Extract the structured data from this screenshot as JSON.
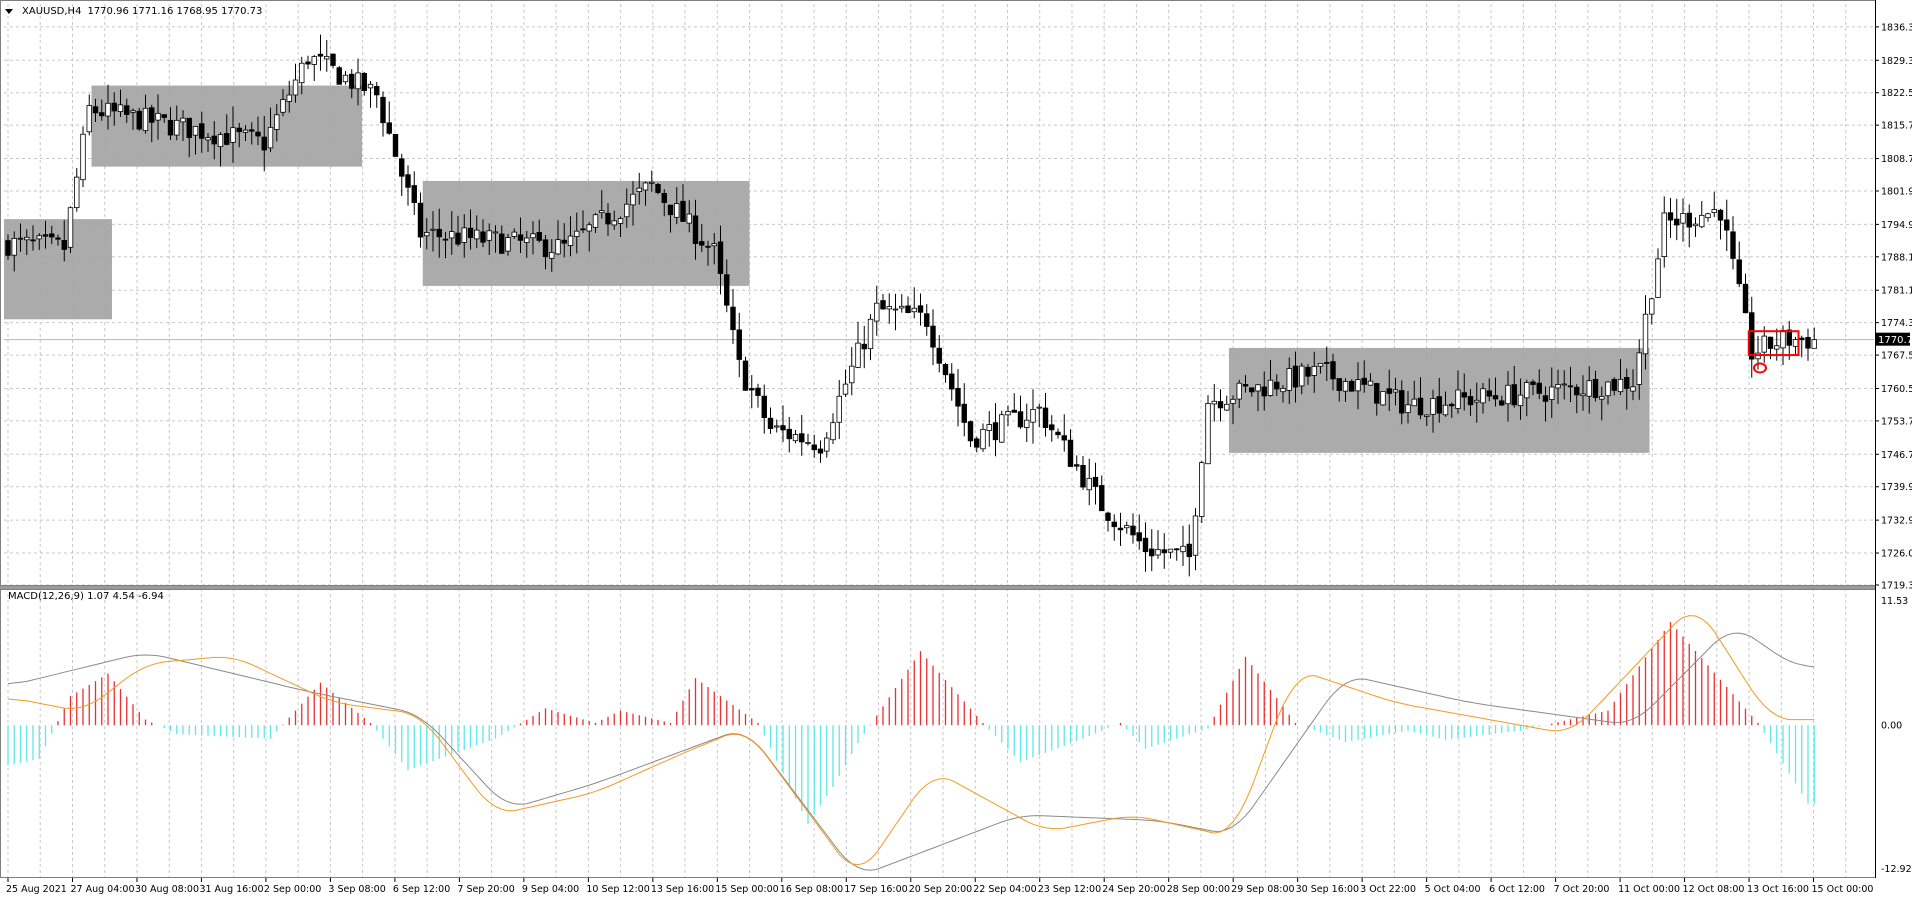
{
  "instrument": {
    "symbol_timeframe": "XAUUSD,H4",
    "ohlc": "1770.96 1771.16 1768.95 1770.73"
  },
  "current_price": "1770.73",
  "indicator": {
    "label": "MACD(12,26,9) 1.07 4.54 -6.94",
    "scale_top": "11.53",
    "scale_zero": "0.00",
    "scale_bottom": "-12.92"
  },
  "colors": {
    "background": "#ffffff",
    "grid": "#c8c8c8",
    "bull_body": "#ffffff",
    "bear_body": "#000000",
    "wick": "#000000",
    "range_box": "#a6a6a6",
    "histogram_positive": "#e8302f",
    "histogram_negative": "#5ee8e8",
    "macd_line": "#f39a22",
    "signal_line": "#8a8a8a",
    "price_line": "#b4b4b4",
    "annotation": "#ff0000"
  },
  "chart_data": [
    {
      "type": "candlestick",
      "y_ticks": [
        "1836.30",
        "1829.30",
        "1822.50",
        "1815.70",
        "1808.70",
        "1801.90",
        "1794.90",
        "1788.10",
        "1781.10",
        "1774.30",
        "1767.50",
        "1760.50",
        "1753.70",
        "1746.70",
        "1739.90",
        "1732.90",
        "1726.00",
        "1719.30"
      ],
      "ylim": [
        1719.3,
        1839.0
      ],
      "x_ticks": [
        "25 Aug 2021",
        "27 Aug 04:00",
        "30 Aug 08:00",
        "31 Aug 16:00",
        "2 Sep 00:00",
        "3 Sep 08:00",
        "6 Sep 12:00",
        "7 Sep 20:00",
        "9 Sep 04:00",
        "10 Sep 12:00",
        "13 Sep 16:00",
        "15 Sep 00:00",
        "16 Sep 08:00",
        "17 Sep 16:00",
        "20 Sep 20:00",
        "22 Sep 04:00",
        "23 Sep 12:00",
        "24 Sep 20:00",
        "28 Sep 00:00",
        "29 Sep 08:00",
        "30 Sep 16:00",
        "3 Oct 22:00",
        "5 Oct 04:00",
        "6 Oct 12:00",
        "7 Oct 20:00",
        "11 Oct 00:00",
        "12 Oct 08:00",
        "13 Oct 16:00",
        "15 Oct 00:00"
      ],
      "last_close": 1770.73,
      "key_points": [
        {
          "bar": 0,
          "price": 1791
        },
        {
          "bar": 10,
          "price": 1790
        },
        {
          "bar": 14,
          "price": 1819
        },
        {
          "bar": 42,
          "price": 1812
        },
        {
          "bar": 49,
          "price": 1830
        },
        {
          "bar": 60,
          "price": 1822
        },
        {
          "bar": 67,
          "price": 1793
        },
        {
          "bar": 90,
          "price": 1790
        },
        {
          "bar": 104,
          "price": 1803
        },
        {
          "bar": 114,
          "price": 1789
        },
        {
          "bar": 118,
          "price": 1765
        },
        {
          "bar": 123,
          "price": 1752
        },
        {
          "bar": 131,
          "price": 1749
        },
        {
          "bar": 140,
          "price": 1777
        },
        {
          "bar": 148,
          "price": 1775
        },
        {
          "bar": 155,
          "price": 1750
        },
        {
          "bar": 166,
          "price": 1756
        },
        {
          "bar": 176,
          "price": 1736
        },
        {
          "bar": 183,
          "price": 1727
        },
        {
          "bar": 190,
          "price": 1725
        },
        {
          "bar": 193,
          "price": 1758
        },
        {
          "bar": 211,
          "price": 1764
        },
        {
          "bar": 225,
          "price": 1757
        },
        {
          "bar": 248,
          "price": 1760
        },
        {
          "bar": 261,
          "price": 1762
        },
        {
          "bar": 266,
          "price": 1795
        },
        {
          "bar": 275,
          "price": 1798
        },
        {
          "bar": 280,
          "price": 1768
        },
        {
          "bar": 285,
          "price": 1770.73
        }
      ],
      "range_boxes": [
        {
          "from_bar": 0,
          "to_bar": 16,
          "high": 1796,
          "low": 1775
        },
        {
          "from_bar": 14,
          "to_bar": 56,
          "high": 1824,
          "low": 1807
        },
        {
          "from_bar": 67,
          "to_bar": 118,
          "high": 1804,
          "low": 1782
        },
        {
          "from_bar": 196,
          "to_bar": 262,
          "high": 1769,
          "low": 1747
        }
      ]
    },
    {
      "type": "macd",
      "ylim": [
        -12.92,
        11.53
      ],
      "macd": {
        "name": "MACD",
        "key_points": [
          [
            0,
            2.5
          ],
          [
            12,
            1.2
          ],
          [
            22,
            5.5
          ],
          [
            36,
            6.2
          ],
          [
            52,
            2.0
          ],
          [
            66,
            1.0
          ],
          [
            78,
            -8.0
          ],
          [
            94,
            -6.0
          ],
          [
            108,
            -2.5
          ],
          [
            118,
            -0.2
          ],
          [
            136,
            -13.8
          ],
          [
            148,
            -4.0
          ],
          [
            166,
            -9.5
          ],
          [
            180,
            -8.0
          ],
          [
            196,
            -10.0
          ],
          [
            206,
            5.0
          ],
          [
            222,
            2.0
          ],
          [
            250,
            -0.8
          ],
          [
            270,
            11.0
          ],
          [
            282,
            0.5
          ]
        ]
      },
      "signal": {
        "name": "Signal",
        "key_points": [
          [
            0,
            3.5
          ],
          [
            22,
            6.5
          ],
          [
            48,
            3.0
          ],
          [
            66,
            1.0
          ],
          [
            80,
            -7.5
          ],
          [
            94,
            -5.2
          ],
          [
            118,
            -0.2
          ],
          [
            136,
            -13.5
          ],
          [
            162,
            -8.0
          ],
          [
            184,
            -8.5
          ],
          [
            196,
            -9.8
          ],
          [
            214,
            4.5
          ],
          [
            234,
            2.0
          ],
          [
            260,
            0.0
          ],
          [
            276,
            9.0
          ],
          [
            286,
            5.2
          ]
        ]
      },
      "histogram": {
        "name": "Histogram",
        "key_points": [
          [
            0,
            -3.6
          ],
          [
            5,
            -3.0
          ],
          [
            10,
            2.6
          ],
          [
            16,
            4.6
          ],
          [
            22,
            0.5
          ],
          [
            27,
            -0.8
          ],
          [
            42,
            -1.2
          ],
          [
            50,
            3.8
          ],
          [
            58,
            0.2
          ],
          [
            64,
            -4.0
          ],
          [
            78,
            -1.2
          ],
          [
            86,
            1.5
          ],
          [
            94,
            0.2
          ],
          [
            98,
            1.3
          ],
          [
            106,
            0.2
          ],
          [
            110,
            4.2
          ],
          [
            120,
            0.2
          ],
          [
            128,
            -8.8
          ],
          [
            132,
            -5.5
          ],
          [
            136,
            -1.6
          ],
          [
            146,
            6.6
          ],
          [
            156,
            0.2
          ],
          [
            162,
            -3.3
          ],
          [
            172,
            -1.2
          ],
          [
            178,
            0.2
          ],
          [
            182,
            -2.1
          ],
          [
            192,
            -0.3
          ],
          [
            198,
            6.1
          ],
          [
            206,
            0.2
          ],
          [
            214,
            -1.5
          ],
          [
            224,
            -0.5
          ],
          [
            230,
            -1.3
          ],
          [
            242,
            -0.5
          ],
          [
            256,
            1.3
          ],
          [
            266,
            9.2
          ],
          [
            280,
            0.2
          ],
          [
            288,
            -7.0
          ]
        ]
      }
    }
  ],
  "annotations": [
    {
      "kind": "rectangle",
      "from_bar": 279,
      "to_bar": 286,
      "high": 1772.5,
      "low": 1767.5
    },
    {
      "kind": "ellipse",
      "bar": 280,
      "price": 1764.8
    }
  ]
}
